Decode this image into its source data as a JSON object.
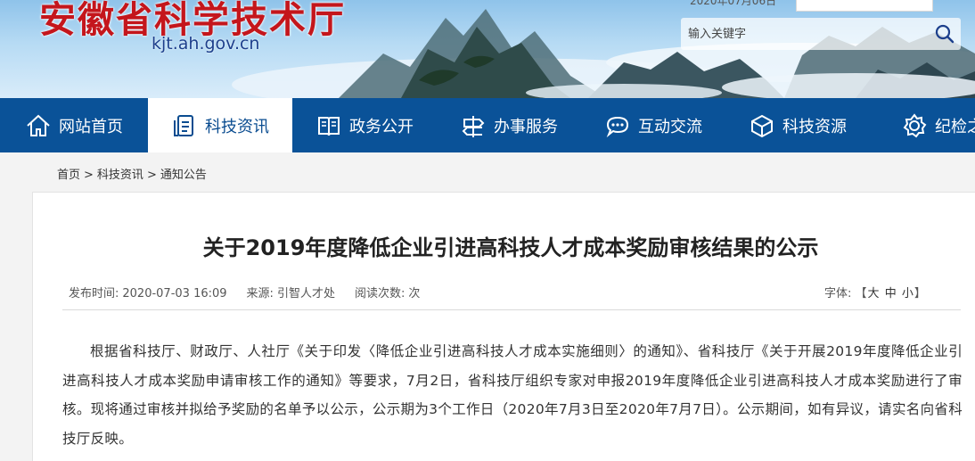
{
  "header": {
    "site_title": "安徽省科学技术厅",
    "site_url": "kjt.ah.gov.cn",
    "date_text": "2020年07月06日",
    "search_placeholder": "输入关键字"
  },
  "nav": {
    "items": [
      {
        "label": "网站首页",
        "icon": "home-icon"
      },
      {
        "label": "科技资讯",
        "icon": "document-icon",
        "active": true
      },
      {
        "label": "政务公开",
        "icon": "book-icon"
      },
      {
        "label": "办事服务",
        "icon": "service-icon"
      },
      {
        "label": "互动交流",
        "icon": "chat-icon"
      },
      {
        "label": "科技资源",
        "icon": "cube-icon"
      },
      {
        "label": "纪检之",
        "icon": "gear-icon"
      }
    ]
  },
  "breadcrumb": {
    "home": "首页",
    "section": "科技资讯",
    "current": "通知公告",
    "separator": ">"
  },
  "article": {
    "title": "关于2019年度降低企业引进高科技人才成本奖励审核结果的公示",
    "publish_label": "发布时间:",
    "publish_time": "2020-07-03 16:09",
    "source_label": "来源:",
    "source": "引智人才处",
    "views_label": "阅读次数:",
    "views_suffix": "次",
    "font_label": "字体:",
    "font_open": "【",
    "font_large": "大",
    "font_medium": "中",
    "font_small": "小",
    "font_close": "】",
    "body": "根据省科技厅、财政厅、人社厅《关于印发〈降低企业引进高科技人才成本实施细则〉的通知》、省科技厅《关于开展2019年度降低企业引进高科技人才成本奖励申请审核工作的通知》等要求，7月2日，省科技厅组织专家对申报2019年度降低企业引进高科技人才成本奖励进行了审核。现将通过审核并拟给予奖励的名单予以公示，公示期为3个工作日（2020年7月3日至2020年7月7日）。公示期间，如有异议，请实名向省科技厅反映。"
  },
  "colors": {
    "title_red": "#c4161c",
    "nav_blue": "#0a5298",
    "url_blue": "#1c3f8c"
  }
}
